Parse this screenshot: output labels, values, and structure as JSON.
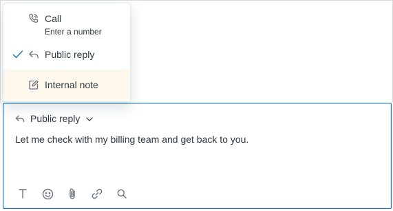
{
  "menu": {
    "items": [
      {
        "label": "Call",
        "sublabel": "Enter a number",
        "icon": "phone-icon",
        "selected": false
      },
      {
        "label": "Public reply",
        "icon": "reply-icon",
        "selected": true
      },
      {
        "label": "Internal note",
        "icon": "note-edit-icon",
        "selected": false,
        "highlighted": true
      }
    ]
  },
  "composer": {
    "channel_label": "Public reply",
    "message": "Let me check with my billing team and get back to you.",
    "toolbar": [
      "text-format-icon",
      "emoji-icon",
      "attachment-icon",
      "link-icon",
      "search-icon"
    ]
  },
  "colors": {
    "accent": "#1f73b7",
    "highlight_bg": "#fdf7ec",
    "text": "#2f3941",
    "icon": "#68737d"
  }
}
